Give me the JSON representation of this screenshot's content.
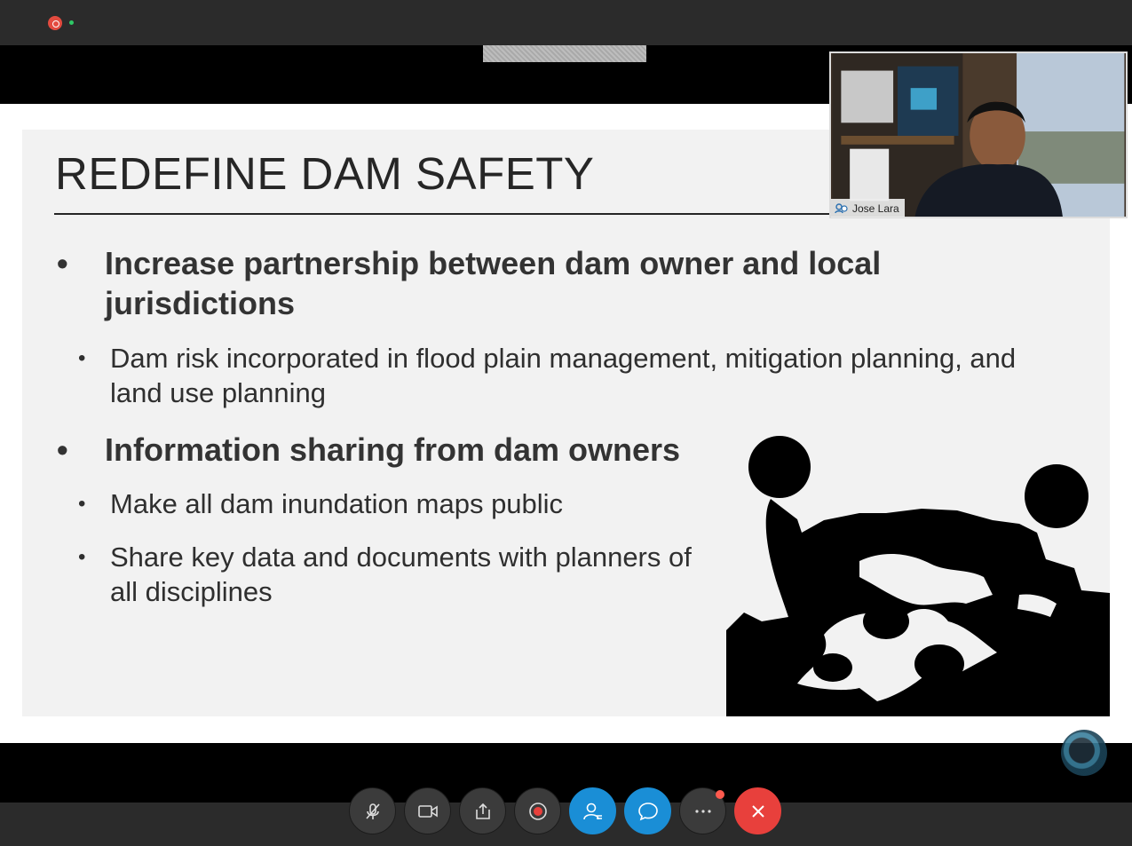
{
  "slide": {
    "title": "REDEFINE DAM SAFETY",
    "bullets": [
      {
        "level": 1,
        "marker": "•",
        "text": "Increase partnership between dam owner and local jurisdictions"
      },
      {
        "level": 2,
        "marker": "•",
        "text": "Dam risk incorporated in flood plain management, mitigation planning, and land use planning"
      },
      {
        "level": 1,
        "marker": "•",
        "text": "Information sharing from dam owners"
      },
      {
        "level": 2,
        "marker": "•",
        "text": "Make all dam inundation maps public"
      },
      {
        "level": 2,
        "marker": "•",
        "text": "Share key data and documents with planners of all disciplines"
      }
    ]
  },
  "participant": {
    "name": "Jose Lara"
  },
  "controls": [
    {
      "id": "mute",
      "icon": "microphone-muted-icon"
    },
    {
      "id": "video",
      "icon": "video-camera-icon"
    },
    {
      "id": "share",
      "icon": "share-upload-icon"
    },
    {
      "id": "record",
      "icon": "record-icon"
    },
    {
      "id": "participants",
      "icon": "participants-icon"
    },
    {
      "id": "chat",
      "icon": "chat-bubble-icon"
    },
    {
      "id": "more",
      "icon": "more-dots-icon"
    },
    {
      "id": "leave",
      "icon": "close-x-icon"
    }
  ],
  "colors": {
    "accent_blue": "#1a8ed6",
    "leave_red": "#e8403c",
    "recording_red": "#e34b3f",
    "live_green": "#2ec866"
  }
}
